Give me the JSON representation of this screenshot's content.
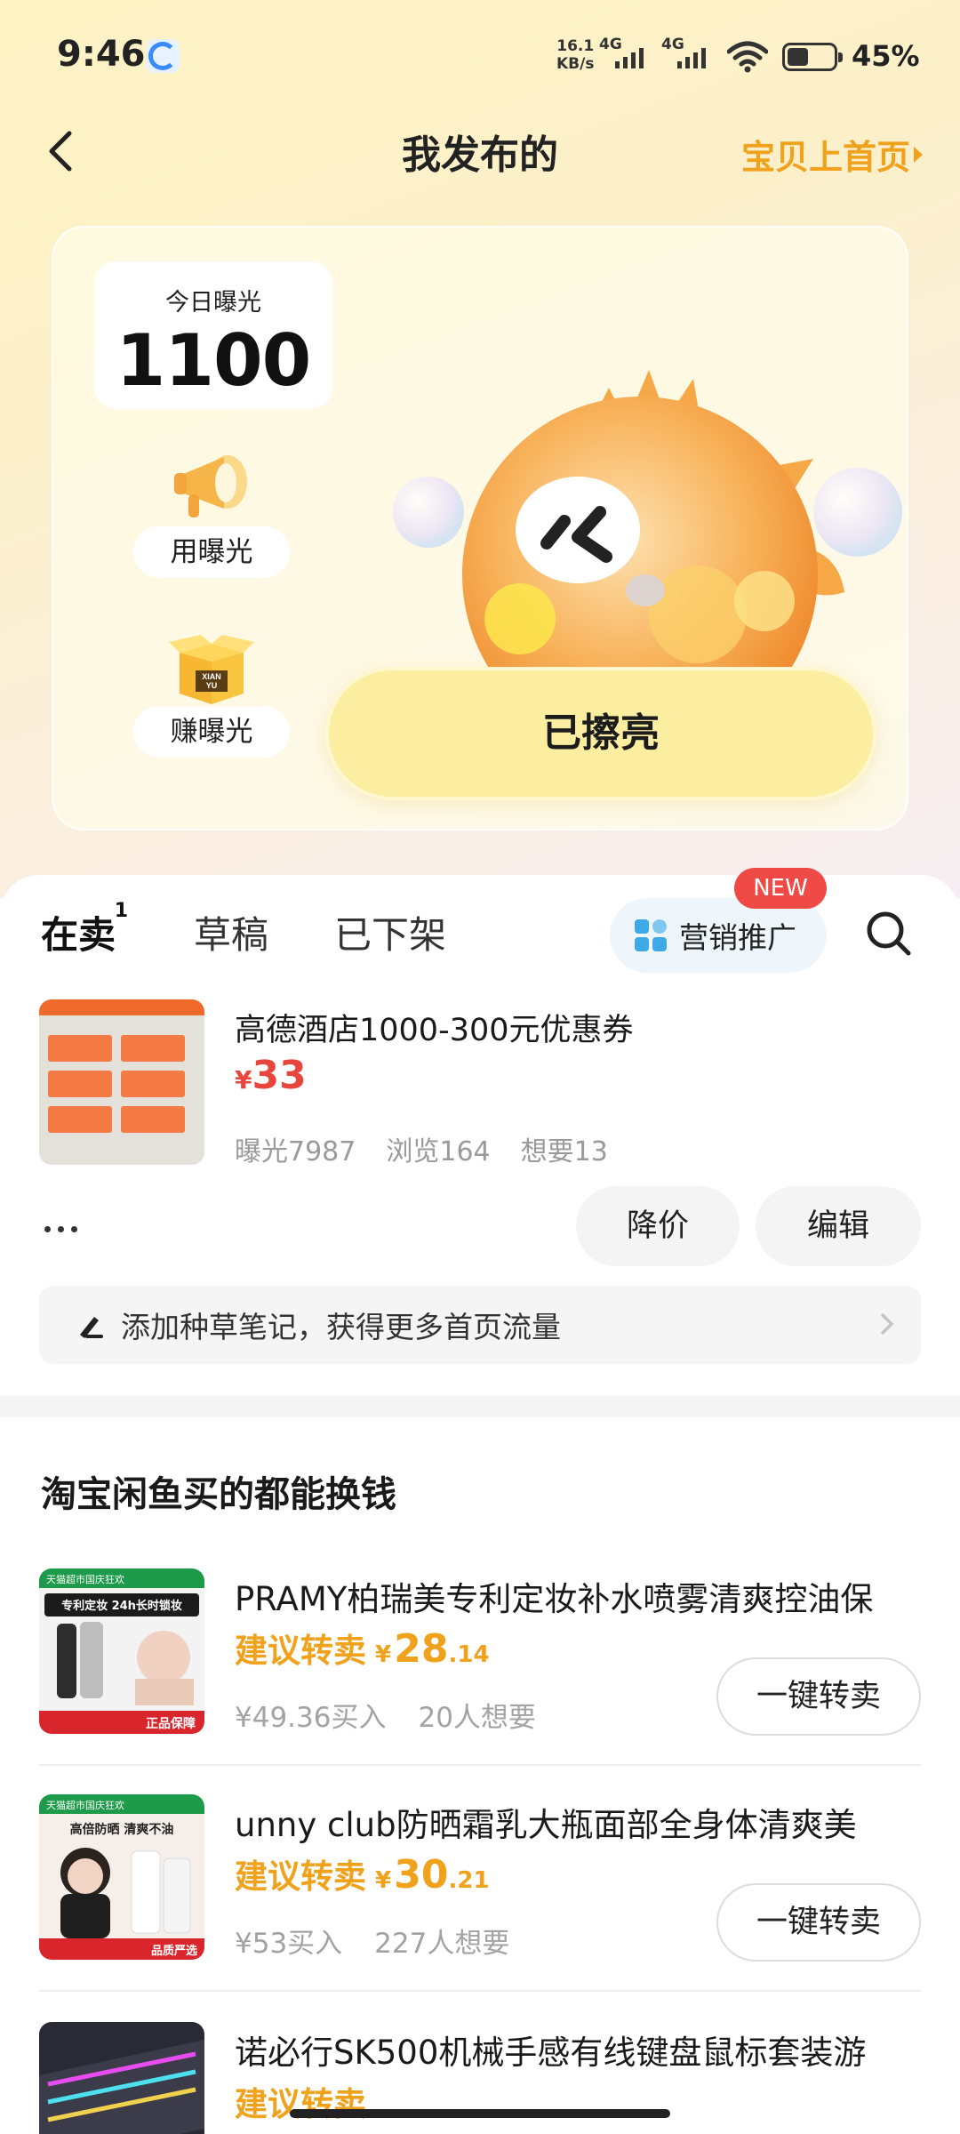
{
  "status_bar": {
    "time": "9:46",
    "net_speed_value": "16.1",
    "net_speed_unit": "KB/s",
    "sig1_label": "4G",
    "sig2_label": "4G",
    "battery_text": "45%",
    "battery_level": 0.45
  },
  "header": {
    "title": "我发布的",
    "right_link": "宝贝上首页"
  },
  "exposure": {
    "label": "今日曝光",
    "value": "1100",
    "use_label": "用曝光",
    "earn_label": "赚曝光",
    "box_brand_line1": "XIAN",
    "box_brand_line2": "YU",
    "lit_button": "已擦亮"
  },
  "tabs": {
    "on_sale": "在卖",
    "on_sale_count": "1",
    "drafts": "草稿",
    "removed": "已下架",
    "promo": "营销推广",
    "new_badge": "NEW"
  },
  "listing": {
    "title": "高德酒店1000-300元优惠券",
    "currency": "¥",
    "price": "33",
    "exposure_stat": "曝光7987",
    "views_stat": "浏览164",
    "wants_stat": "想要13",
    "reduce_price": "降价",
    "edit": "编辑",
    "note_prompt": "添加种草笔记，获得更多首页流量"
  },
  "resell_section": {
    "title": "淘宝闲鱼买的都能换钱",
    "suggest_label": "建议转卖",
    "currency": "¥",
    "button_label": "一键转卖",
    "items": [
      {
        "title": "PRAMY柏瑞美专利定妆补水喷雾清爽控油保",
        "price_int": "28",
        "price_dec": ".14",
        "bought": "¥49.36买入",
        "wants": "20人想要",
        "thumb_top_label": "天猫超市国庆狂欢",
        "thumb_headline": "专利定妆 24h长时锁妆",
        "thumb_footer": "正品保障"
      },
      {
        "title": "unny club防晒霜乳大瓶面部全身体清爽美",
        "price_int": "30",
        "price_dec": ".21",
        "bought": "¥53买入",
        "wants": "227人想要",
        "thumb_top_label": "天猫超市国庆狂欢",
        "thumb_headline": "高倍防晒 清爽不油",
        "thumb_footer": "品质严选"
      },
      {
        "title": "诺必行SK500机械手感有线键盘鼠标套装游",
        "price_int": "",
        "price_dec": "",
        "bought": "",
        "wants": ""
      }
    ]
  },
  "colors": {
    "accent_orange": "#f0a21c",
    "price_red": "#e8453c",
    "badge_red": "#ef4a45",
    "highlight_yellow": "#ffe14a",
    "button_yellow": "#fbeea1"
  }
}
